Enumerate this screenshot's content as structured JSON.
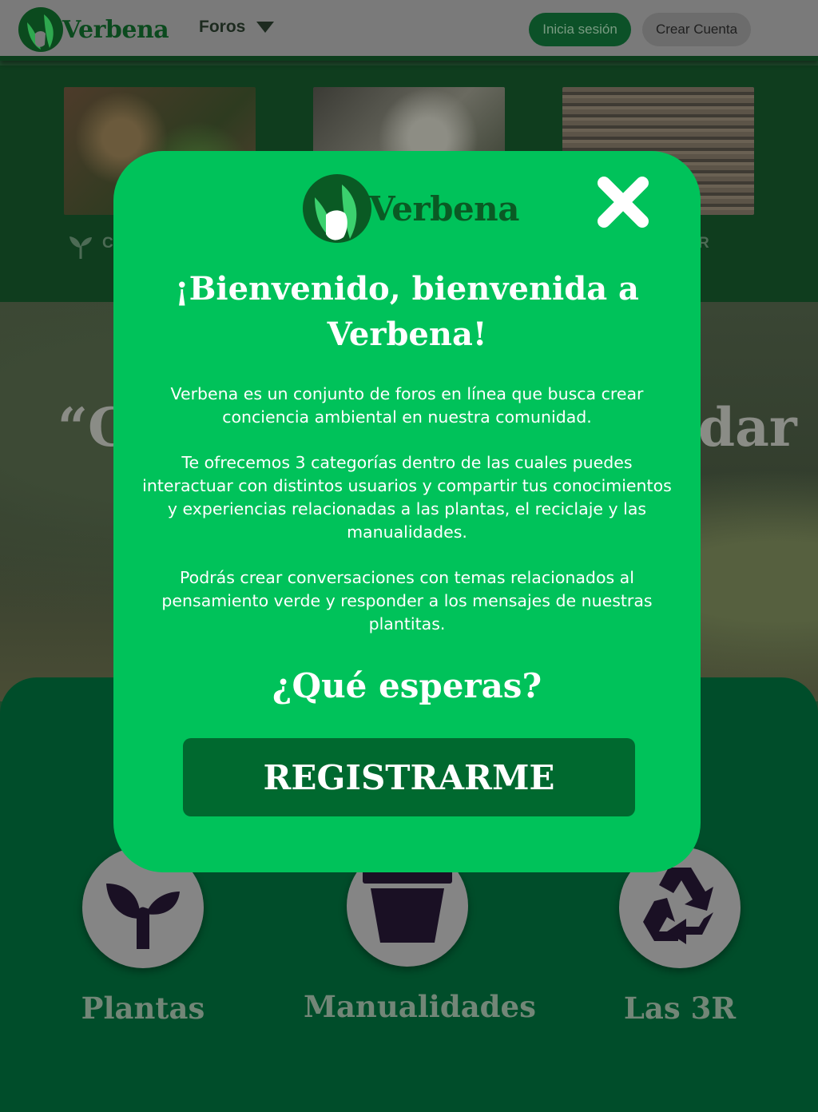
{
  "header": {
    "brand": "Verbena",
    "forums_menu_label": "Foros",
    "login_label": "Inicia sesión",
    "signup_label": "Crear Cuenta"
  },
  "category_strip": {
    "left_label_partial": "C",
    "right_label_partial": "R"
  },
  "hero": {
    "quote_left_partial": "“C",
    "quote_right_partial": "dar"
  },
  "forums": {
    "items": [
      {
        "label": "Plantas",
        "icon": "plant-icon"
      },
      {
        "label": "Manualidades",
        "icon": "flowerpot-icon"
      },
      {
        "label": "Las 3R",
        "icon": "recycle-icon"
      }
    ]
  },
  "modal": {
    "brand": "Verbena",
    "title": "¡Bienvenido, bienvenida a Verbena!",
    "paragraph_1": "Verbena es un conjunto de foros en línea que busca crear conciencia ambiental en nuestra comunidad.",
    "paragraph_2": "Te ofrecemos 3 categorías dentro de las cuales puedes interactuar con distintos usuarios y compartir tus conocimientos y experiencias relacionadas a las plantas, el reciclaje y las manualidades.",
    "paragraph_3": "Podrás crear conversaciones con temas relacionados al pensamiento verde y responder a los mensajes de nuestras plantitas.",
    "cta_text": "¿Qué esperas?",
    "register_label": "REGISTRARME",
    "close_icon": "close-icon"
  },
  "colors": {
    "modal_bg": "#00c25a",
    "register_button": "#00692f",
    "header_bg": "#7a7a7a",
    "forum_section_bg": "#004d2a",
    "brand_dark": "#0a5a24"
  }
}
